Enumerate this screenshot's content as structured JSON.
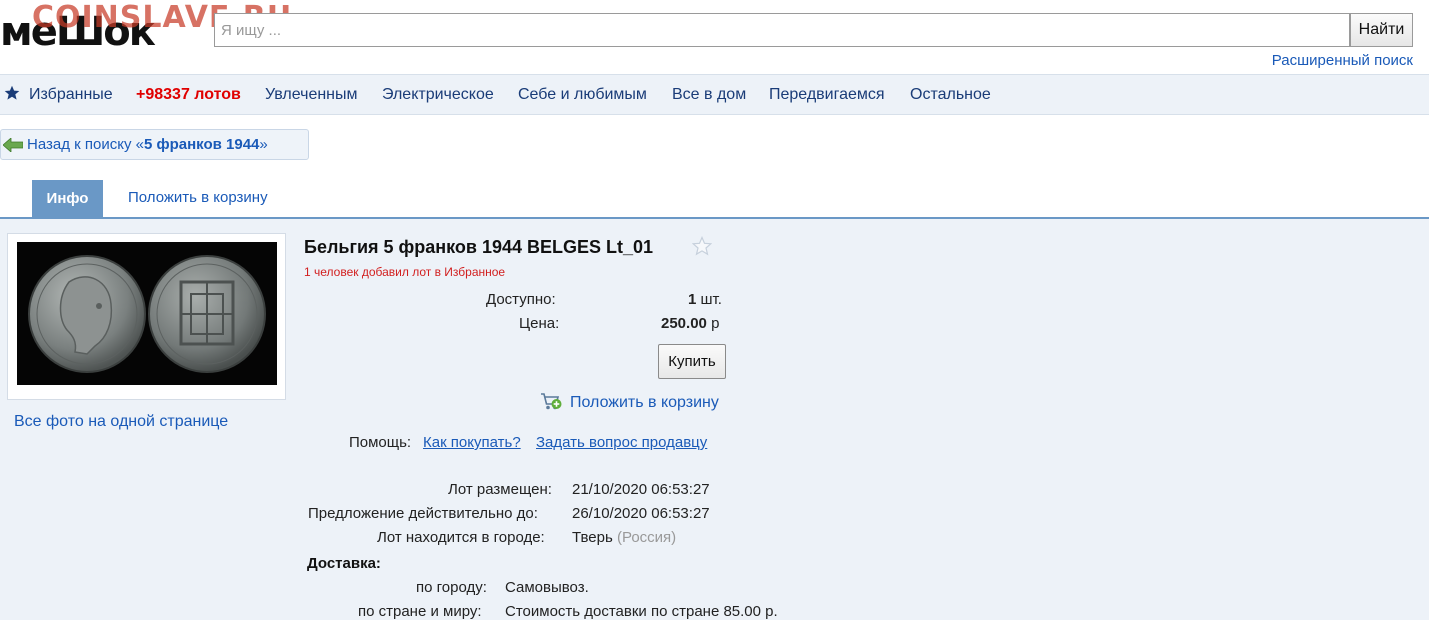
{
  "header": {
    "logo_text": "меШок",
    "watermark": "COINSLAVE.RU",
    "search_placeholder": "Я ищу ...",
    "search_button": "Найти",
    "advanced_search": "Расширенный поиск"
  },
  "nav": {
    "favorites": "Избранные",
    "lots_count": "+98337 лотов",
    "items": [
      "Увлеченным",
      "Электрическое",
      "Себе и любимым",
      "Все в дом",
      "Передвигаемся",
      "Остальное"
    ]
  },
  "back": {
    "prefix": "Назад к поиску «",
    "query": "5 франков 1944",
    "suffix": "»"
  },
  "tabs": {
    "info": "Инфо",
    "cart": "Положить в корзину"
  },
  "lot": {
    "title": "Бельгия 5 франков 1944 BELGES Lt_01",
    "fav_note": "1 человек добавил лот в Избранное",
    "available_label": "Доступно:",
    "available_value": "1",
    "available_unit": "шт.",
    "price_label": "Цена:",
    "price_value": "250.00",
    "price_currency": "р",
    "buy_button": "Купить",
    "cart_link": "Положить в корзину",
    "help_label": "Помощь:",
    "help_how": "Как покупать?",
    "help_ask": "Задать вопрос продавцу",
    "placed_label": "Лот размещен:",
    "placed_value": "21/10/2020 06:53:27",
    "valid_label": "Предложение действительно до:",
    "valid_value": "26/10/2020 06:53:27",
    "city_label": "Лот находится в городе:",
    "city_value": "Тверь",
    "country_value": "(Россия)",
    "delivery_title": "Доставка:",
    "delivery_city_label": "по городу:",
    "delivery_city_value": "Самовывоз.",
    "delivery_world_label": "по стране и миру:",
    "delivery_world_value": "Стоимость доставки по стране 85.00 р.",
    "all_photos": "Все фото на одной странице"
  },
  "colors": {
    "accent_blue": "#6a98c6",
    "link_blue": "#1a5ab8",
    "lots_red": "#e00000",
    "panel_bg": "#edf2f8"
  }
}
